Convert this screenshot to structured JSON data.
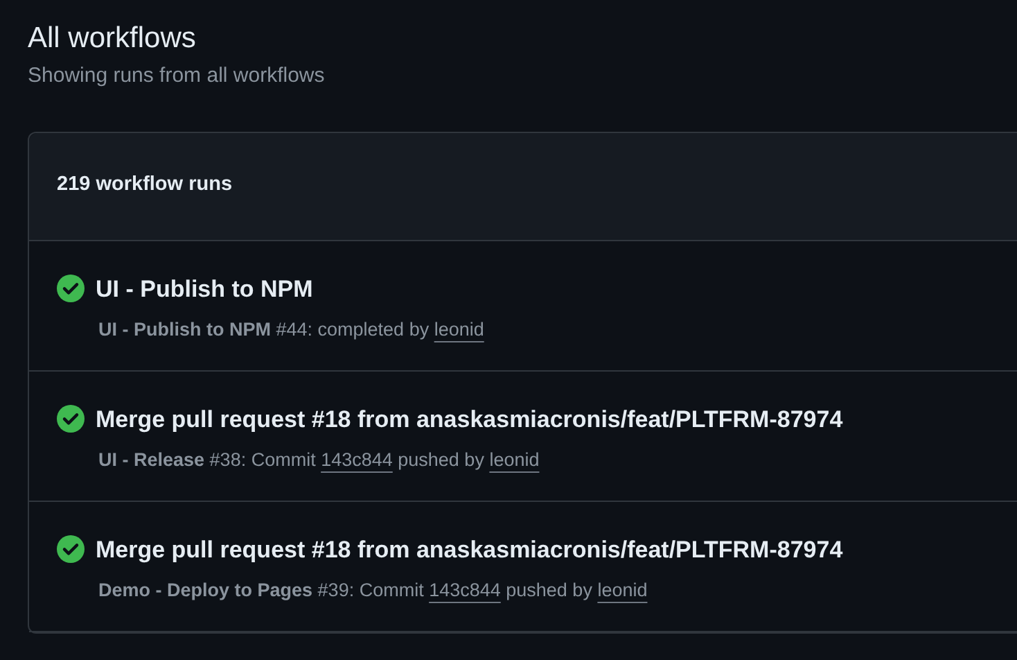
{
  "header": {
    "title": "All workflows",
    "subtitle": "Showing runs from all workflows"
  },
  "runs_list": {
    "count": "219 workflow runs",
    "runs": [
      {
        "kind": "success",
        "title": "UI - Publish to NPM",
        "workflow": "UI - Publish to NPM",
        "run_text": "#44: completed by",
        "actor": "leonid"
      },
      {
        "kind": "success",
        "title": "Merge pull request #18 from anaskasmiacronis/feat/PLTFRM-87974",
        "workflow": "UI - Release",
        "run_text": "#38: Commit",
        "commit": "143c844",
        "by_text": "pushed by",
        "actor": "leonid"
      },
      {
        "kind": "success",
        "title": "Merge pull request #18 from anaskasmiacronis/feat/PLTFRM-87974",
        "workflow": "Demo - Deploy to Pages",
        "run_text": "#39: Commit",
        "commit": "143c844",
        "by_text": "pushed by",
        "actor": "leonid"
      }
    ]
  }
}
